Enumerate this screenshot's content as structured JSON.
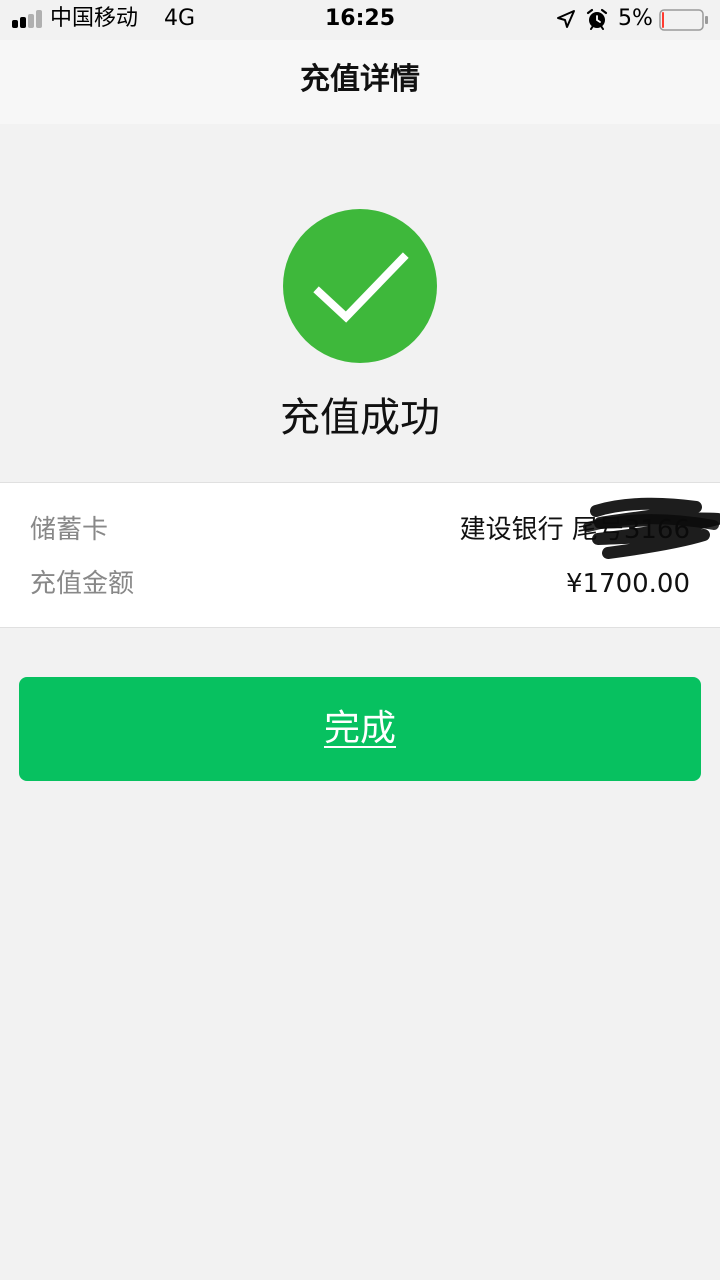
{
  "status_bar": {
    "carrier": "中国移动",
    "network": "4G",
    "time": "16:25",
    "battery_percent": "5%",
    "battery_level": 0.05,
    "icons": [
      "signal-icon",
      "location-icon",
      "alarm-icon",
      "battery-icon"
    ]
  },
  "nav": {
    "title": "充值详情"
  },
  "result": {
    "icon": "check-circle-icon",
    "text": "充值成功",
    "icon_color": "#3eb83b"
  },
  "details": {
    "card_label": "储蓄卡",
    "card_value": "建设银行 尾号3166",
    "amount_label": "充值金额",
    "amount_value": "¥1700.00"
  },
  "actions": {
    "done_label": "完成",
    "button_color": "#07c160"
  }
}
